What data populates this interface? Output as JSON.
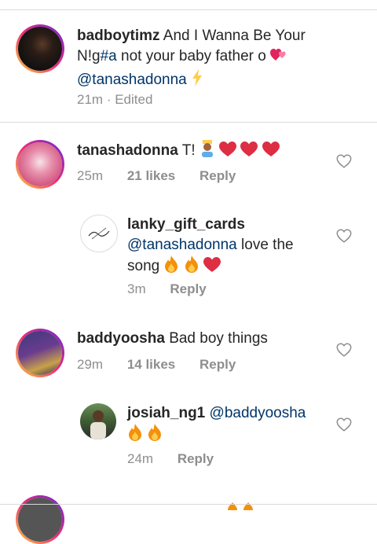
{
  "caption": {
    "username": "badboytimz",
    "text_line1": "And I Wanna Be Your",
    "text_line2_pre": "N!g",
    "text_line2_hashtag": "#a",
    "text_line2_post": " not your baby father o ",
    "mention": "@tanashadonna",
    "time": "21m",
    "edited": "· Edited"
  },
  "comments": [
    {
      "username": "tanashadonna",
      "text": "T!",
      "time": "25m",
      "likes": "21 likes",
      "reply": "Reply"
    },
    {
      "username": "lanky_gift_cards",
      "mention": "@tanashadonna",
      "text": " love the",
      "text2": "song",
      "time": "3m",
      "reply": "Reply"
    },
    {
      "username": "baddyoosha",
      "text": "Bad boy things",
      "time": "29m",
      "likes": "14 likes",
      "reply": "Reply"
    },
    {
      "username": "josiah_ng1",
      "mention": "@baddyoosha",
      "time": "24m",
      "reply": "Reply"
    }
  ],
  "colors": {
    "mention": "#003569",
    "meta": "#8e8e8e",
    "heart_emoji": "#e0245e",
    "fire": "#f4900c"
  }
}
